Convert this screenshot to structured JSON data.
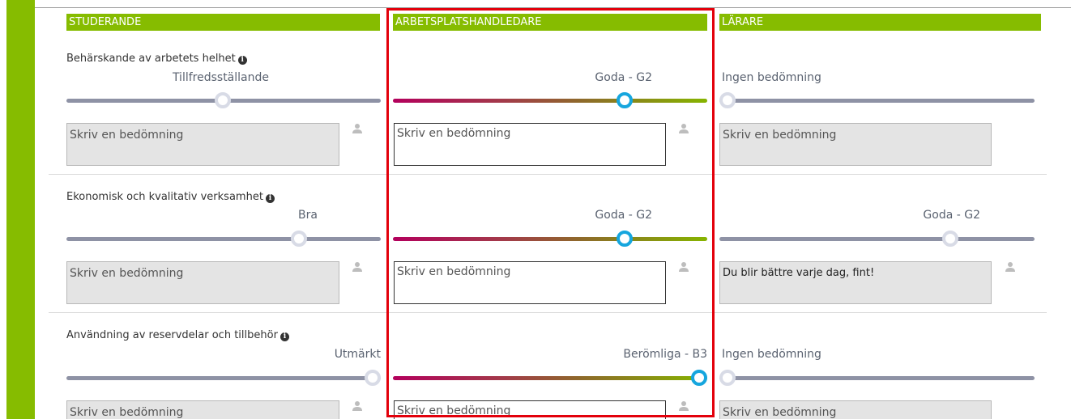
{
  "columns": {
    "student": "STUDERANDE",
    "supervisor": "ARBETSPLATSHANDLEDARE",
    "teacher": "LÄRARE"
  },
  "placeholder": "Skriv en bedömning",
  "icons": {
    "info": "info-icon",
    "person": "person-icon"
  },
  "colors": {
    "accent": "#86bc00",
    "highlight": "#e3000b",
    "knob_active": "#16a6de"
  },
  "criteria": [
    {
      "title": "Behärskande av arbetets helhet",
      "student_grade": "Tillfredsställande",
      "supervisor_grade": "Goda - G2",
      "teacher_grade": "Ingen bedömning",
      "student_level": 0.5,
      "supervisor_level": 0.75,
      "teacher_level": 0.0,
      "teacher_comment": ""
    },
    {
      "title": "Ekonomisk och kvalitativ verksamhet",
      "student_grade": "Bra",
      "supervisor_grade": "Goda - G2",
      "teacher_grade": "Goda - G2",
      "student_level": 0.75,
      "supervisor_level": 0.75,
      "teacher_level": 0.75,
      "teacher_comment": "Du blir bättre varje dag, fint!"
    },
    {
      "title": "Användning av reservdelar och tillbehör",
      "student_grade": "Utmärkt",
      "supervisor_grade": "Berömliga - B3",
      "teacher_grade": "Ingen bedömning",
      "student_level": 1.0,
      "supervisor_level": 1.0,
      "teacher_level": 0.0,
      "teacher_comment": ""
    }
  ]
}
